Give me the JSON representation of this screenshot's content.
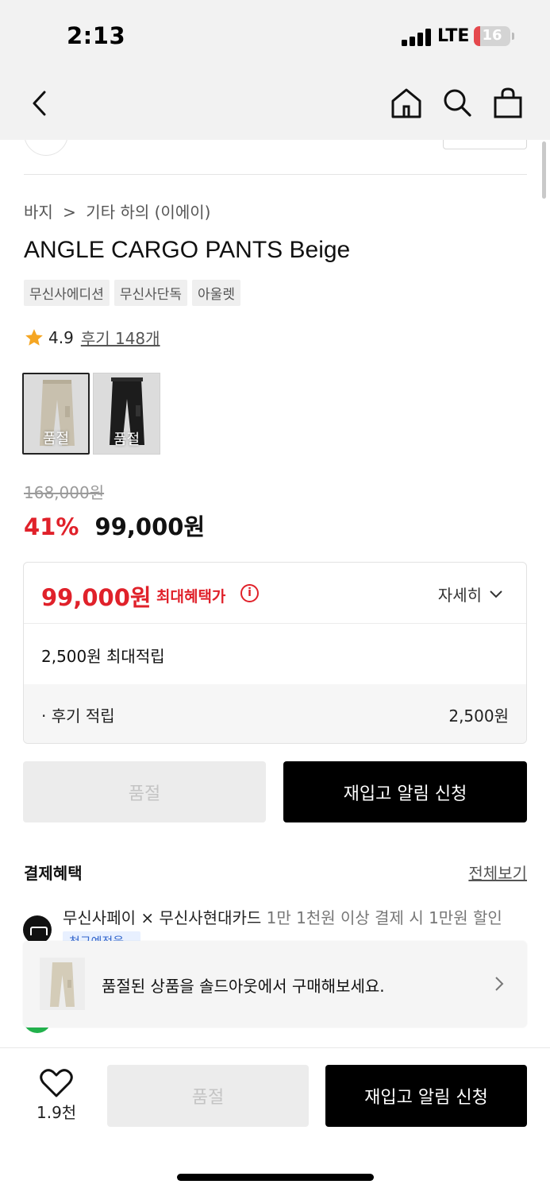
{
  "status_bar": {
    "time": "2:13",
    "network": "LTE",
    "battery": "16"
  },
  "breadcrumb": {
    "items": [
      "바지",
      "기타 하의 (이에이)"
    ],
    "separator": ">"
  },
  "product": {
    "title": "ANGLE CARGO PANTS Beige",
    "tags": [
      "무신사에디션",
      "무신사단독",
      "아울렛"
    ],
    "rating": "4.9",
    "reviews": "후기 148개",
    "variants": [
      {
        "label": "품절",
        "color": "beige",
        "selected": true
      },
      {
        "label": "품절",
        "color": "black",
        "selected": false
      }
    ],
    "original_price": "168,000원",
    "discount": "41%",
    "price": "99,000원"
  },
  "benefit": {
    "price": "99,000원",
    "max_label": "최대혜택가",
    "info_icon": "i",
    "detail_label": "자세히",
    "points": "2,500원 최대적립",
    "sub_label": "· 후기 적립",
    "sub_value": "2,500원"
  },
  "buttons": {
    "sold_out": "품절",
    "restock": "재입고 알림 신청"
  },
  "payment": {
    "title": "결제혜택",
    "view_all": "전체보기",
    "text_main": "무신사페이 × 무신사현대카드",
    "text_condition": " 1만 1천원 이상 결제 시 1만원 할인",
    "badge": "청구예정율"
  },
  "banner": {
    "text": "품절된 상품을 솔드아웃에서 구매해보세요."
  },
  "bottom_bar": {
    "like_count": "1.9천",
    "sold_out": "품절",
    "restock": "재입고 알림 신청"
  },
  "colors": {
    "accent_red": "#e0212a",
    "black": "#000000",
    "sold_gray": "#ececec"
  }
}
